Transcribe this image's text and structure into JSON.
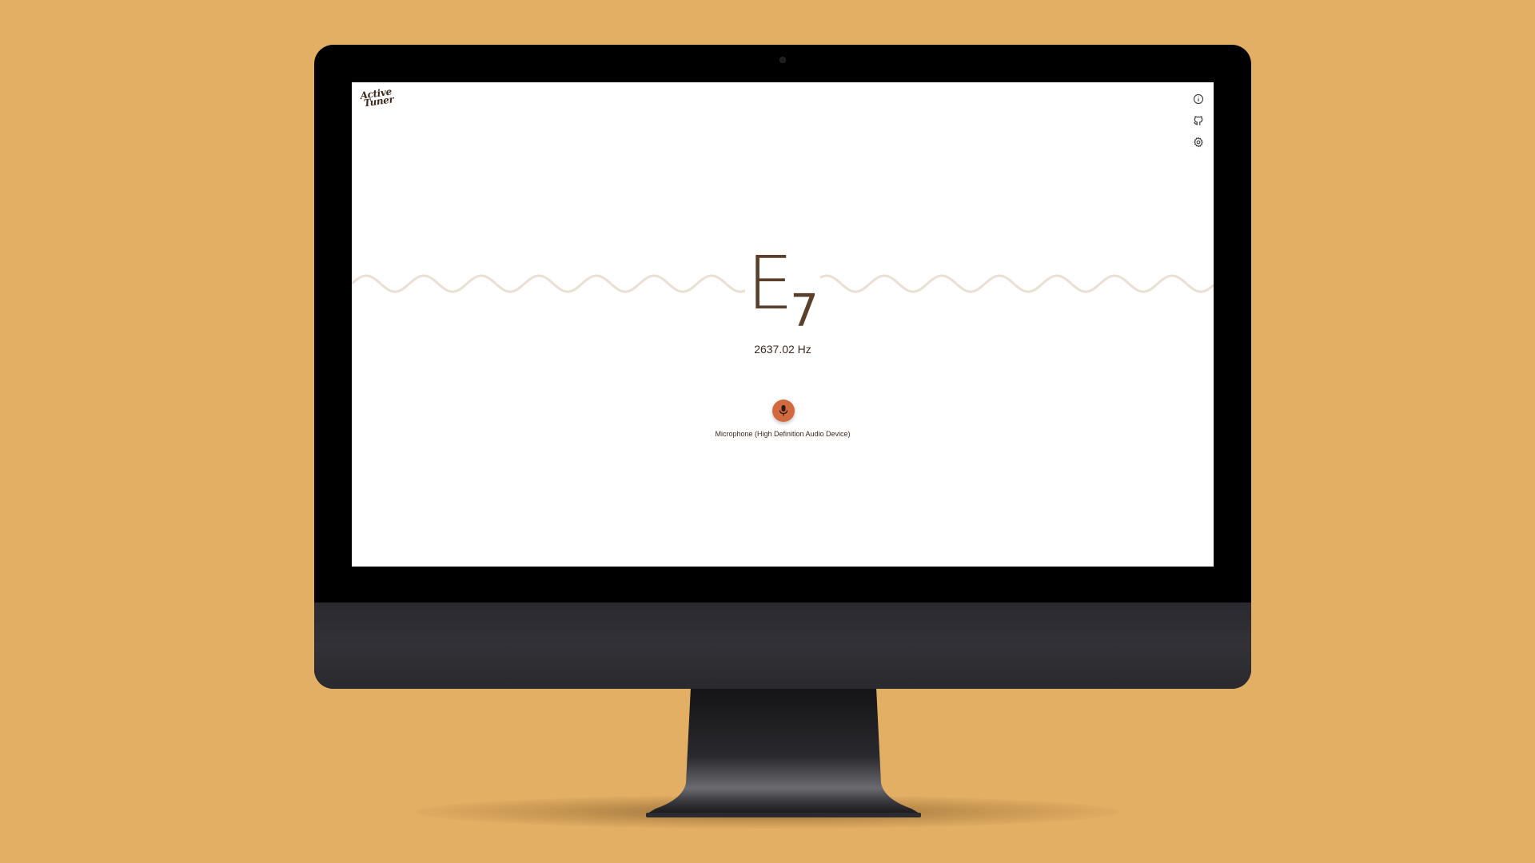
{
  "background_color": "#E3AF65",
  "app": {
    "logo_line1": "Active",
    "logo_line2": "Tuner"
  },
  "top_icons": [
    {
      "name": "info-icon"
    },
    {
      "name": "github-icon"
    },
    {
      "name": "gear-icon"
    }
  ],
  "tuner": {
    "note": "E",
    "octave": "7",
    "frequency": "2637.02 Hz",
    "wave_color": "#EBDFD3",
    "note_color": "#5A3F2B"
  },
  "microphone": {
    "button_color": "#D2693F",
    "icon": "microphone-icon",
    "device_label": "Microphone (High Definition Audio Device)"
  }
}
